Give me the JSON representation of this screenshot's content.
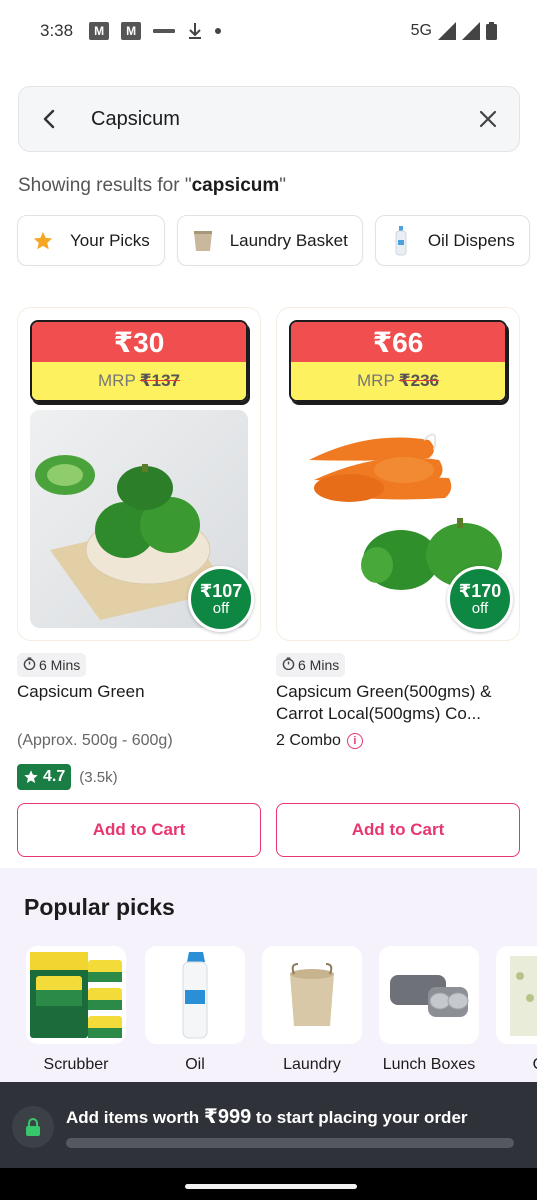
{
  "status_bar": {
    "time": "3:38",
    "network": "5G",
    "icons": [
      "gmail-icon",
      "gmail-icon",
      "tag-icon",
      "download-icon",
      "dot-icon",
      "signal-icon",
      "signal-icon",
      "battery-icon"
    ]
  },
  "search": {
    "value": "Capsicum",
    "back_icon": "back-arrow-icon",
    "clear_icon": "close-icon"
  },
  "results": {
    "prefix": "Showing results for \"",
    "query": "capsicum",
    "suffix": "\""
  },
  "chips": [
    {
      "label": "Your Picks",
      "icon": "star-icon"
    },
    {
      "label": "Laundry Basket",
      "icon": "basket-icon"
    },
    {
      "label": "Oil Dispens",
      "icon": "bottle-icon"
    }
  ],
  "products": [
    {
      "price": "₹30",
      "mrp_label": "MRP",
      "mrp_value": "₹137",
      "off_amount": "₹107",
      "off_text": "off",
      "delivery": "6 Mins",
      "name": "Capsicum Green",
      "qty": "(Approx. 500g - 600g)",
      "rating": "4.7",
      "rating_count": "(3.5k)",
      "cta": "Add to Cart"
    },
    {
      "price": "₹66",
      "mrp_label": "MRP",
      "mrp_value": "₹236",
      "off_amount": "₹170",
      "off_text": "off",
      "delivery": "6 Mins",
      "name": "Capsicum Green(500gms) & Carrot Local(500gms) Co...",
      "qty": "2 Combo",
      "cta": "Add to Cart"
    }
  ],
  "popular": {
    "title": "Popular picks",
    "items": [
      {
        "label": "Scrubber"
      },
      {
        "label": "Oil"
      },
      {
        "label": "Laundry"
      },
      {
        "label": "Lunch Boxes"
      },
      {
        "label": "Org"
      }
    ]
  },
  "cart_banner": {
    "pre": "Add items worth ",
    "amount": "₹999",
    "post": " to start placing your order",
    "progress": 0
  },
  "colors": {
    "accent": "#e8366f",
    "price_red": "#f04e4f",
    "mrp_yellow": "#fdf15f",
    "offer_green": "#0e8742",
    "rating_green": "#1a7d43"
  }
}
